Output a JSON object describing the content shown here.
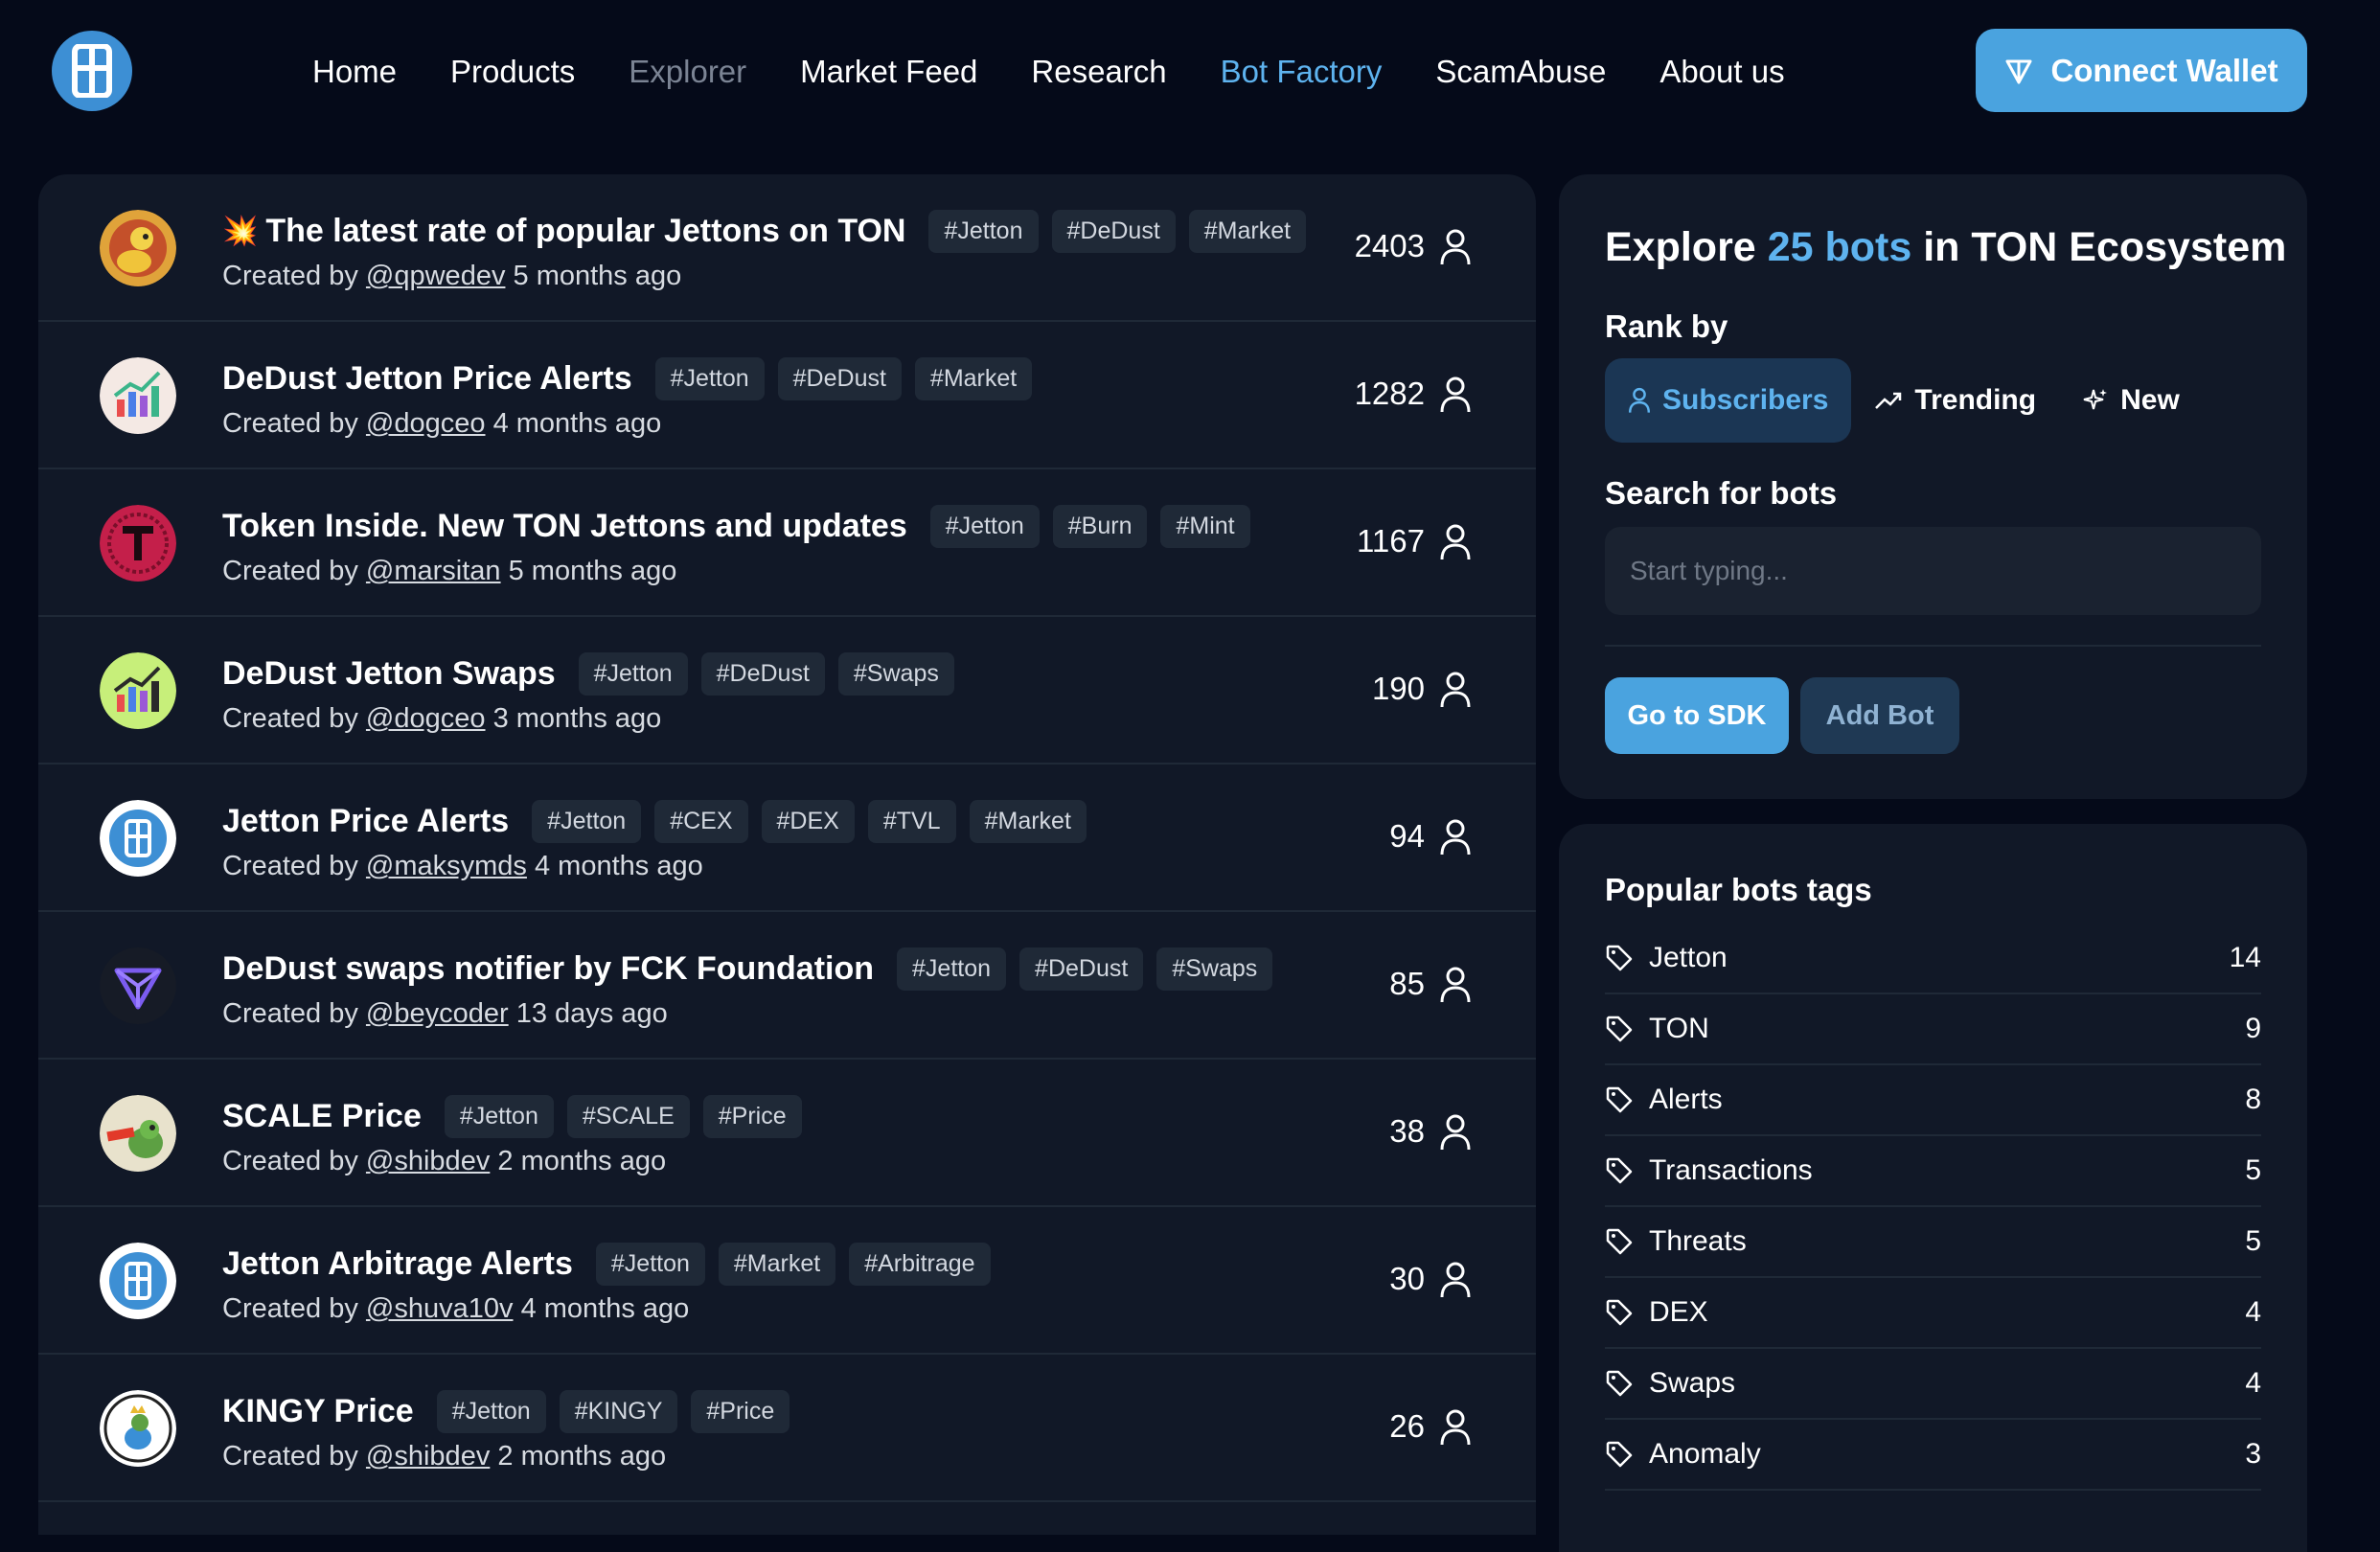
{
  "header": {
    "nav": [
      {
        "label": "Home",
        "state": "normal"
      },
      {
        "label": "Products",
        "state": "normal"
      },
      {
        "label": "Explorer",
        "state": "muted"
      },
      {
        "label": "Market Feed",
        "state": "normal"
      },
      {
        "label": "Research",
        "state": "normal"
      },
      {
        "label": "Bot Factory",
        "state": "active"
      },
      {
        "label": "ScamAbuse",
        "state": "normal"
      },
      {
        "label": "About us",
        "state": "normal"
      }
    ],
    "wallet_label": "Connect Wallet"
  },
  "bots": [
    {
      "title": "The latest rate of popular Jettons on TON",
      "emoji": "💥",
      "tags": [
        "#Jetton",
        "#DeDust",
        "#Market"
      ],
      "created_prefix": "Created by",
      "author": "@qpwedev",
      "age": "5 months ago",
      "subscribers": "2403",
      "avatar": "duck"
    },
    {
      "title": "DeDust Jetton Price Alerts",
      "tags": [
        "#Jetton",
        "#DeDust",
        "#Market"
      ],
      "created_prefix": "Created by",
      "author": "@dogceo",
      "age": "4 months ago",
      "subscribers": "1282",
      "avatar": "chart-light"
    },
    {
      "title": "Token Inside. New TON Jettons and updates",
      "tags": [
        "#Jetton",
        "#Burn",
        "#Mint"
      ],
      "created_prefix": "Created by",
      "author": "@marsitan",
      "age": "5 months ago",
      "subscribers": "1167",
      "avatar": "token-inside"
    },
    {
      "title": "DeDust Jetton Swaps",
      "tags": [
        "#Jetton",
        "#DeDust",
        "#Swaps"
      ],
      "created_prefix": "Created by",
      "author": "@dogceo",
      "age": "3 months ago",
      "subscribers": "190",
      "avatar": "chart-green"
    },
    {
      "title": "Jetton Price Alerts",
      "tags": [
        "#Jetton",
        "#CEX",
        "#DEX",
        "#TVL",
        "#Market"
      ],
      "created_prefix": "Created by",
      "author": "@maksymds",
      "age": "4 months ago",
      "subscribers": "94",
      "avatar": "logo"
    },
    {
      "title": "DeDust swaps notifier by FCK Foundation",
      "tags": [
        "#Jetton",
        "#DeDust",
        "#Swaps"
      ],
      "created_prefix": "Created by",
      "author": "@beycoder",
      "age": "13 days ago",
      "subscribers": "85",
      "avatar": "triangle"
    },
    {
      "title": "SCALE Price",
      "tags": [
        "#Jetton",
        "#SCALE",
        "#Price"
      ],
      "created_prefix": "Created by",
      "author": "@shibdev",
      "age": "2 months ago",
      "subscribers": "38",
      "avatar": "frog"
    },
    {
      "title": "Jetton Arbitrage Alerts",
      "tags": [
        "#Jetton",
        "#Market",
        "#Arbitrage"
      ],
      "created_prefix": "Created by",
      "author": "@shuva10v",
      "age": "4 months ago",
      "subscribers": "30",
      "avatar": "logo"
    },
    {
      "title": "KINGY Price",
      "tags": [
        "#Jetton",
        "#KINGY",
        "#Price"
      ],
      "created_prefix": "Created by",
      "author": "@shibdev",
      "age": "2 months ago",
      "subscribers": "26",
      "avatar": "kingy"
    }
  ],
  "explore": {
    "title_prefix": "Explore",
    "title_count": "25 bots",
    "title_suffix": "in TON Ecosystem",
    "rank_label": "Rank by",
    "rank_tabs": [
      {
        "label": "Subscribers",
        "icon": "user-icon",
        "active": true
      },
      {
        "label": "Trending",
        "icon": "trending-icon",
        "active": false
      },
      {
        "label": "New",
        "icon": "sparkle-icon",
        "active": false
      }
    ],
    "search_label": "Search for bots",
    "search_placeholder": "Start typing...",
    "sdk_label": "Go to SDK",
    "add_label": "Add Bot"
  },
  "popular_tags": {
    "title": "Popular bots tags",
    "items": [
      {
        "name": "Jetton",
        "count": "14"
      },
      {
        "name": "TON",
        "count": "9"
      },
      {
        "name": "Alerts",
        "count": "8"
      },
      {
        "name": "Transactions",
        "count": "5"
      },
      {
        "name": "Threats",
        "count": "5"
      },
      {
        "name": "DEX",
        "count": "4"
      },
      {
        "name": "Swaps",
        "count": "4"
      },
      {
        "name": "Anomaly",
        "count": "3"
      }
    ]
  },
  "colors": {
    "accent": "#5eb3ef",
    "button": "#4aa3df",
    "background": "#050a19",
    "panel": "#111827"
  }
}
